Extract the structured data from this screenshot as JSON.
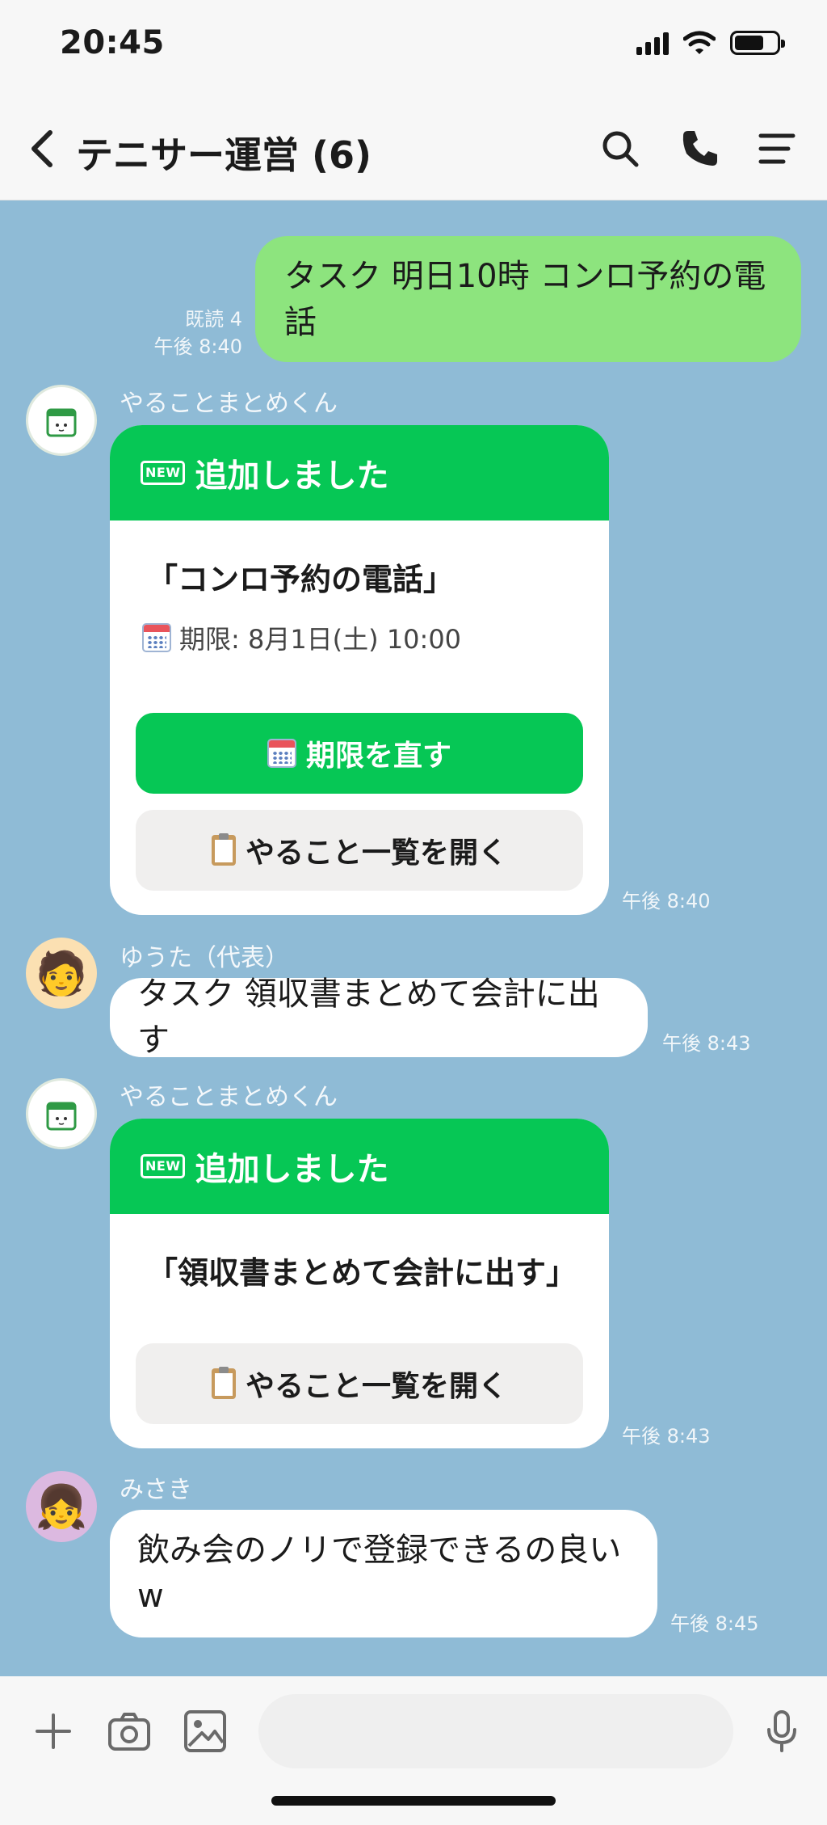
{
  "status_bar": {
    "time": "20:45"
  },
  "header": {
    "title": "テニサー運営 (6)"
  },
  "messages": {
    "me": {
      "text": "タスク 明日10時 コンロ予約の電話",
      "read": "既読 4",
      "time": "午後 8:40"
    },
    "bot1": {
      "sender": "やることまとめくん",
      "badge": "NEW",
      "header": "追加しました",
      "title": "「コンロ予約の電話」",
      "due": "期限: 8月1日(土) 10:00",
      "fix_button": "期限を直す",
      "list_button": "やること一覧を開く",
      "time": "午後 8:40"
    },
    "yuta": {
      "sender": "ゆうた（代表）",
      "text": "タスク 領収書まとめて会計に出す",
      "time": "午後 8:43"
    },
    "bot2": {
      "sender": "やることまとめくん",
      "badge": "NEW",
      "header": "追加しました",
      "title": "「領収書まとめて会計に出す」",
      "list_button": "やること一覧を開く",
      "time": "午後 8:43"
    },
    "misaki": {
      "sender": "みさき",
      "text": "飲み会のノリで登録できるの良い w",
      "time": "午後 8:45"
    }
  },
  "colors": {
    "chat_bg": "#8fbbd6",
    "my_bubble": "#8de47e",
    "line_green": "#06c755"
  },
  "icons": [
    "back-icon",
    "search-icon",
    "phone-icon",
    "menu-icon",
    "plus-icon",
    "camera-icon",
    "image-icon",
    "microphone-icon"
  ]
}
